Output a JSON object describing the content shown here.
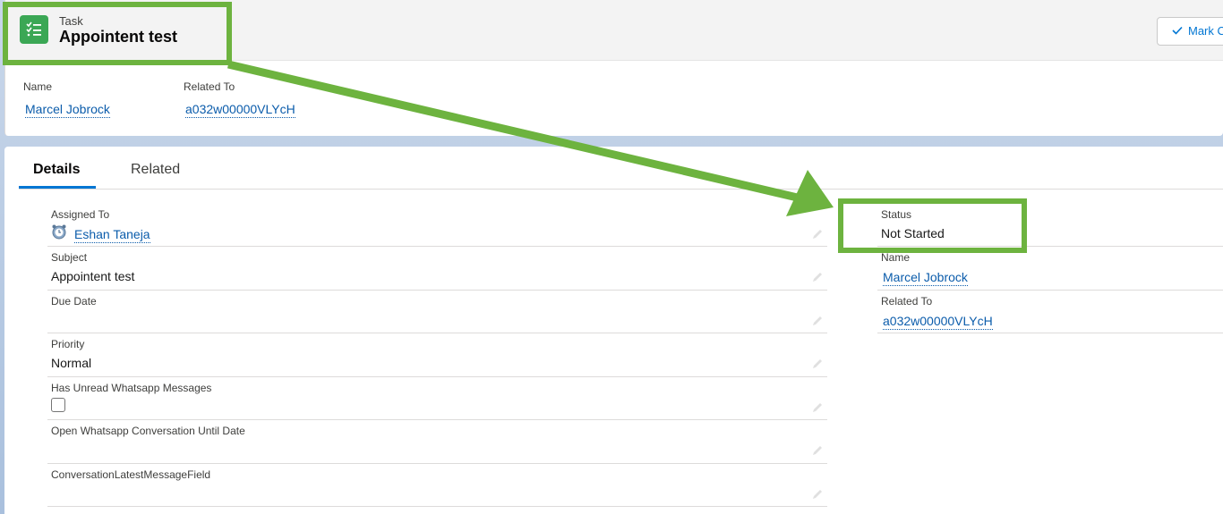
{
  "header": {
    "object_label": "Task",
    "title": "Appointent test",
    "mark_button_label": "Mark C",
    "highlights": [
      {
        "label": "Name",
        "value": "Marcel Jobrock"
      },
      {
        "label": "Related To",
        "value": "a032w00000VLYcH"
      }
    ]
  },
  "tabs": [
    "Details",
    "Related"
  ],
  "left_fields": [
    {
      "label": "Assigned To",
      "value": "Eshan Taneja",
      "type": "user-link"
    },
    {
      "label": "Subject",
      "value": "Appointent test",
      "type": "text"
    },
    {
      "label": "Due Date",
      "value": "",
      "type": "text"
    },
    {
      "label": "Priority",
      "value": "Normal",
      "type": "text"
    },
    {
      "label": "Has Unread Whatsapp Messages",
      "value": "",
      "type": "checkbox"
    },
    {
      "label": "Open Whatsapp Conversation Until Date",
      "value": "",
      "type": "text"
    },
    {
      "label": "ConversationLatestMessageField",
      "value": "",
      "type": "text"
    }
  ],
  "right_fields": [
    {
      "label": "Status",
      "value": "Not Started",
      "type": "text"
    },
    {
      "label": "Name",
      "value": "Marcel Jobrock",
      "type": "link"
    },
    {
      "label": "Related To",
      "value": "a032w00000VLYcH",
      "type": "link"
    }
  ],
  "colors": {
    "annotation": "#6db33f",
    "brand": "#0176d3",
    "task_icon": "#3ba755"
  }
}
